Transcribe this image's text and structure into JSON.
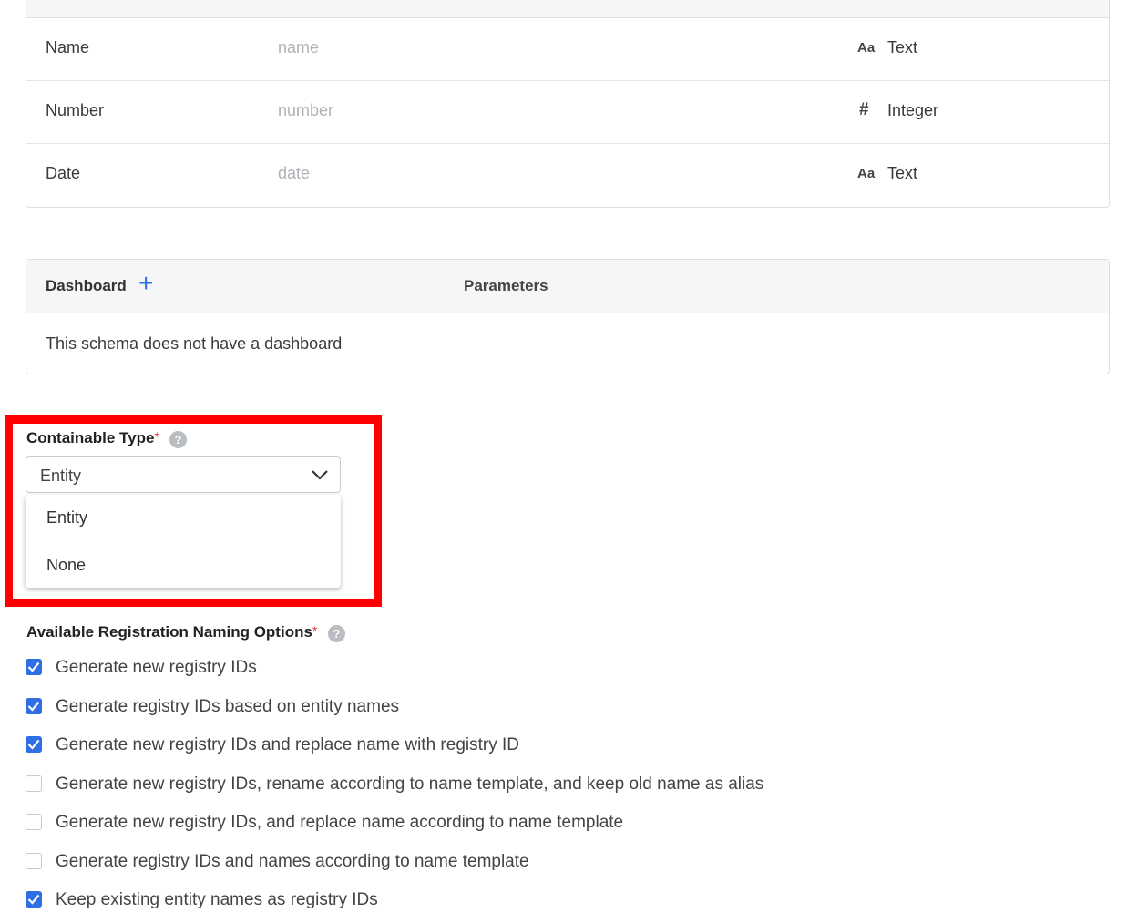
{
  "fields": [
    {
      "name": "Name",
      "key": "name",
      "type_icon": "Aa",
      "type": "Text"
    },
    {
      "name": "Number",
      "key": "number",
      "type_icon": "#",
      "type": "Integer"
    },
    {
      "name": "Date",
      "key": "date",
      "type_icon": "Aa",
      "type": "Text"
    }
  ],
  "dashboard": {
    "title": "Dashboard",
    "add_label": "+",
    "params_label": "Parameters",
    "empty_text": "This schema does not have a dashboard"
  },
  "containable_type": {
    "label": "Containable Type",
    "required_mark": "*",
    "help": "?",
    "selected": "Entity",
    "options": [
      "Entity",
      "None"
    ]
  },
  "naming": {
    "label": "Available Registration Naming Options",
    "required_mark": "*",
    "help": "?",
    "options": [
      {
        "label": "Generate new registry IDs",
        "checked": true
      },
      {
        "label": "Generate registry IDs based on entity names",
        "checked": true
      },
      {
        "label": "Generate new registry IDs and replace name with registry ID",
        "checked": true
      },
      {
        "label": "Generate new registry IDs, rename according to name template, and keep old name as alias",
        "checked": false
      },
      {
        "label": "Generate new registry IDs, and replace name according to name template",
        "checked": false
      },
      {
        "label": "Generate registry IDs and names according to name template",
        "checked": false
      },
      {
        "label": "Keep existing entity names as registry IDs",
        "checked": true
      }
    ]
  },
  "colors": {
    "accent": "#2f6ee3",
    "highlight": "#ff0000",
    "required": "#e03a3a"
  }
}
